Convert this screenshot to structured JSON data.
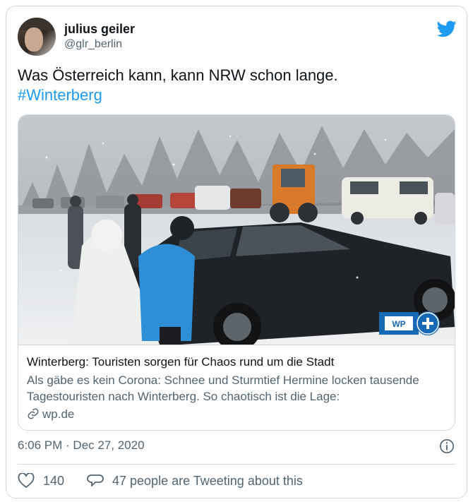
{
  "author": {
    "name": "julius geiler",
    "handle": "@glr_berlin"
  },
  "tweet": {
    "text": "Was Österreich kann, kann NRW schon lange.",
    "hashtag": "#Winterberg"
  },
  "card": {
    "title": "Winterberg: Touristen sorgen für Chaos rund um die Stadt",
    "description": "Als gäbe es kein Corona: Schnee und Sturmtief Hermine locken tausende Tagestouristen nach Winterberg. So chaotisch ist die Lage:",
    "domain": "wp.de",
    "badge": "WP"
  },
  "meta": {
    "timestamp": "6:06 PM · Dec 27, 2020"
  },
  "actions": {
    "likes": "140",
    "conversation": "47 people are Tweeting about this"
  },
  "colors": {
    "brand_blue": "#1d9bf0",
    "secondary_text": "#536471",
    "border": "#cfd9de"
  },
  "icons": {
    "platform": "twitter-bird-icon",
    "link": "link-icon",
    "info": "info-icon",
    "like": "heart-icon",
    "reply": "speech-bubble-icon"
  }
}
